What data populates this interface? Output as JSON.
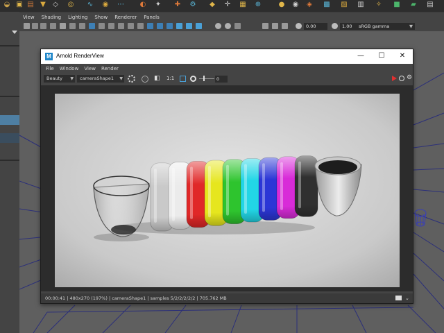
{
  "viewport_menu": {
    "items": [
      "View",
      "Shading",
      "Lighting",
      "Show",
      "Renderer",
      "Panels"
    ]
  },
  "viewport_toolbar": {
    "exposure_value": "0.00",
    "gamma_value": "1.00",
    "color_space": "sRGB gamma"
  },
  "render_view": {
    "title": "Arnold RenderView",
    "logo_letter": "M",
    "window_controls": {
      "minimize": "—",
      "maximize": "☐",
      "close": "✕"
    },
    "menu": [
      "File",
      "Window",
      "View",
      "Render"
    ],
    "aov_selected": "Beauty",
    "camera_selected": "cameraShape1",
    "ratio_label": "1:1",
    "exposure_value": "0",
    "status": "00:00:41 | 480x270 (197%) | cameraShape1 | samples 5/2/2/2/2/2 | 705.762 MB"
  },
  "render_image": {
    "ring_colors": [
      "#c9c9c9",
      "#ebebeb",
      "#e02828",
      "#e6e61e",
      "#2ec42e",
      "#22d6e6",
      "#2b36d6",
      "#d82bd8",
      "#303030"
    ]
  },
  "colors": {
    "accent_blue": "#1e86c9",
    "render_red": "#e03030"
  }
}
